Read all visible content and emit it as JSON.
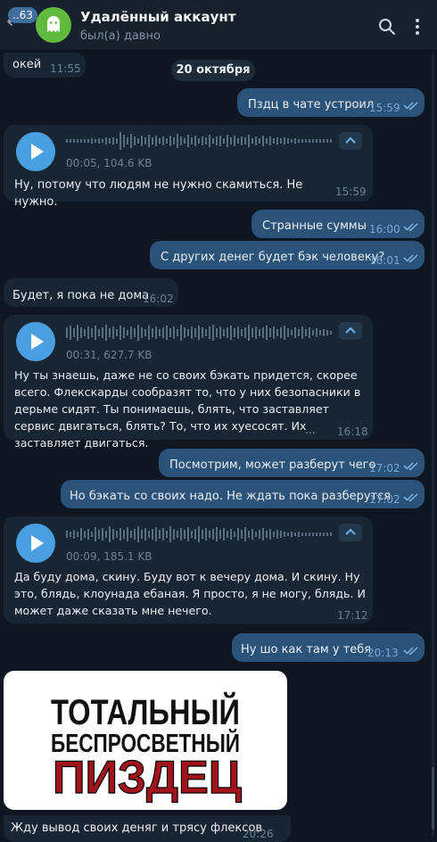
{
  "header": {
    "unread_badge": "..63",
    "contact_name": "Удалённый аккаунт",
    "status": "был(а) давно"
  },
  "icons": {
    "back": "arrow-left-icon",
    "avatar": "ghost-icon",
    "search": "search-icon",
    "menu": "more-vertical-icon",
    "play": "play-icon",
    "collapse": "chevron-up-icon",
    "read": "double-check-icon"
  },
  "colors": {
    "background": "#0e1621",
    "header": "#17212b",
    "incoming_bubble": "#182533",
    "outgoing_bubble": "#2b5278",
    "accent": "#4a9fe0",
    "avatar": "#5fba3e",
    "image_text_black": "#111111",
    "image_text_red": "#a1141c"
  },
  "date_separator": "20 октября",
  "messages": [
    {
      "dir": "in",
      "text": "окей",
      "time": "11:55"
    },
    {
      "dir": "out",
      "text": "Пздц в чате устроил",
      "time": "15:59"
    },
    {
      "dir": "in",
      "type": "voice",
      "meta": "00:05, 104.6 KB",
      "text": "Ну, потому что людям не нужно скамиться. Не нужно.",
      "time": "15:59"
    },
    {
      "dir": "out",
      "text": "Странные суммы",
      "time": "16:00"
    },
    {
      "dir": "out",
      "text": "С других денег будет бэк человеку?",
      "time": "16:01"
    },
    {
      "dir": "in",
      "text": "Будет, я пока не дома",
      "time": "16:02"
    },
    {
      "dir": "in",
      "type": "voice",
      "meta": "00:31, 627.7 KB",
      "text": "Ну ты знаешь, даже не со своих бэкать придется, скорее всего. Флекскарды сообразят то, что у них безопасники в дерьме сидят. Ты понимаешь, блять, что заставляет сервис двигаться, блять? То, что их хуесосят. Их заставляет двигаться.",
      "more": "...",
      "time": "16:18"
    },
    {
      "dir": "out",
      "text": "Посмотрим, может разберут чего",
      "time": "17:02"
    },
    {
      "dir": "out",
      "text": "Но бэкать со своих надо. Не ждать пока разберутся",
      "time": "17:02"
    },
    {
      "dir": "in",
      "type": "voice",
      "meta": "00:09, 185.1 KB",
      "text": "Да буду дома, скину. Буду вот к вечеру дома. И скину. Ну это, блядь, клоунада ебаная. Я просто, я не могу, блядь. И может даже сказать мне нечего.",
      "time": "17:12"
    },
    {
      "dir": "out",
      "text": "Ну шо как там у тебя",
      "time": "20:13"
    },
    {
      "dir": "in",
      "type": "image",
      "image_lines": [
        "ТОТАЛЬНЫЙ",
        "БЕСПРОСВЕТНЫЙ",
        "ПИЗДЕЦ"
      ],
      "caption": "Жду вывод своих деняг и трясу флексов",
      "time": "20:26"
    }
  ]
}
